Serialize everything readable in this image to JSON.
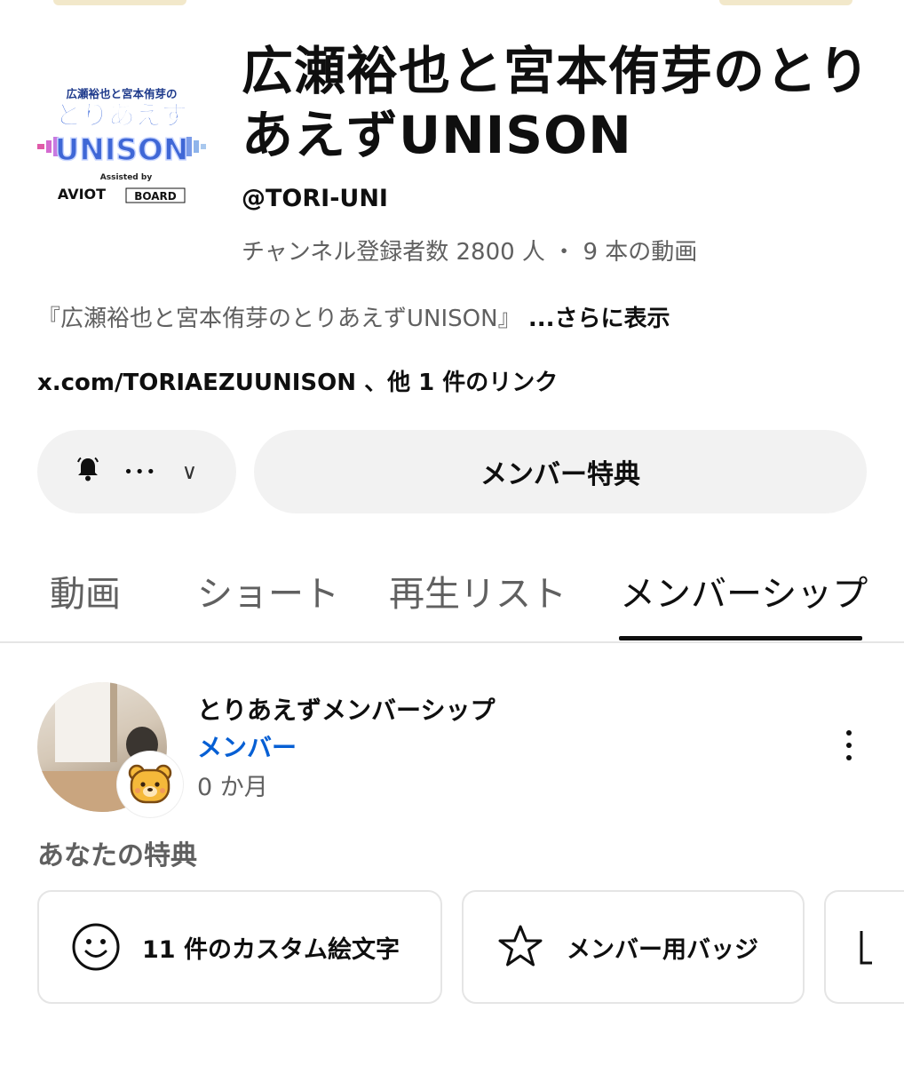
{
  "channel": {
    "title": "広瀬裕也と宮本侑芽のとりあえずUNISON",
    "logo_text": {
      "top": "広瀬裕也と宮本侑芽の",
      "middle": "とりあえず",
      "main": "UNISON",
      "assisted": "Assisted by",
      "sponsor1": "AVIOT",
      "sponsor2": "BOARD"
    },
    "handle": "@TORI-UNI",
    "stats": "チャンネル登録者数 2800 人 ・ 9 本の動画",
    "description": "『広瀬裕也と宮本侑芽のとりあえずUNISON』",
    "more_label": "...さらに表示",
    "links": "x.com/TORIAEZUUNISON 、他 1 件のリンク"
  },
  "actions": {
    "bell_icon": "bell-icon",
    "dots_label": "•••",
    "chevron_label": "∨",
    "perks_button_label": "メンバー特典"
  },
  "tabs": [
    {
      "label": "動画",
      "active": false
    },
    {
      "label": "ショート",
      "active": false
    },
    {
      "label": "再生リスト",
      "active": false
    },
    {
      "label": "メンバーシップ",
      "active": true
    }
  ],
  "membership": {
    "title": "とりあえずメンバーシップ",
    "role": "メンバー",
    "duration": "0 か月",
    "perks_heading": "あなたの特典",
    "perks": [
      {
        "icon": "smiley-icon",
        "label": "11 件のカスタム絵文字"
      },
      {
        "icon": "star-icon",
        "label": "メンバー用バッジ"
      }
    ]
  },
  "colors": {
    "text": "#0f0f0f",
    "secondary": "#606060",
    "link_blue": "#065fd4",
    "chip_bg": "#f2f2f2"
  }
}
